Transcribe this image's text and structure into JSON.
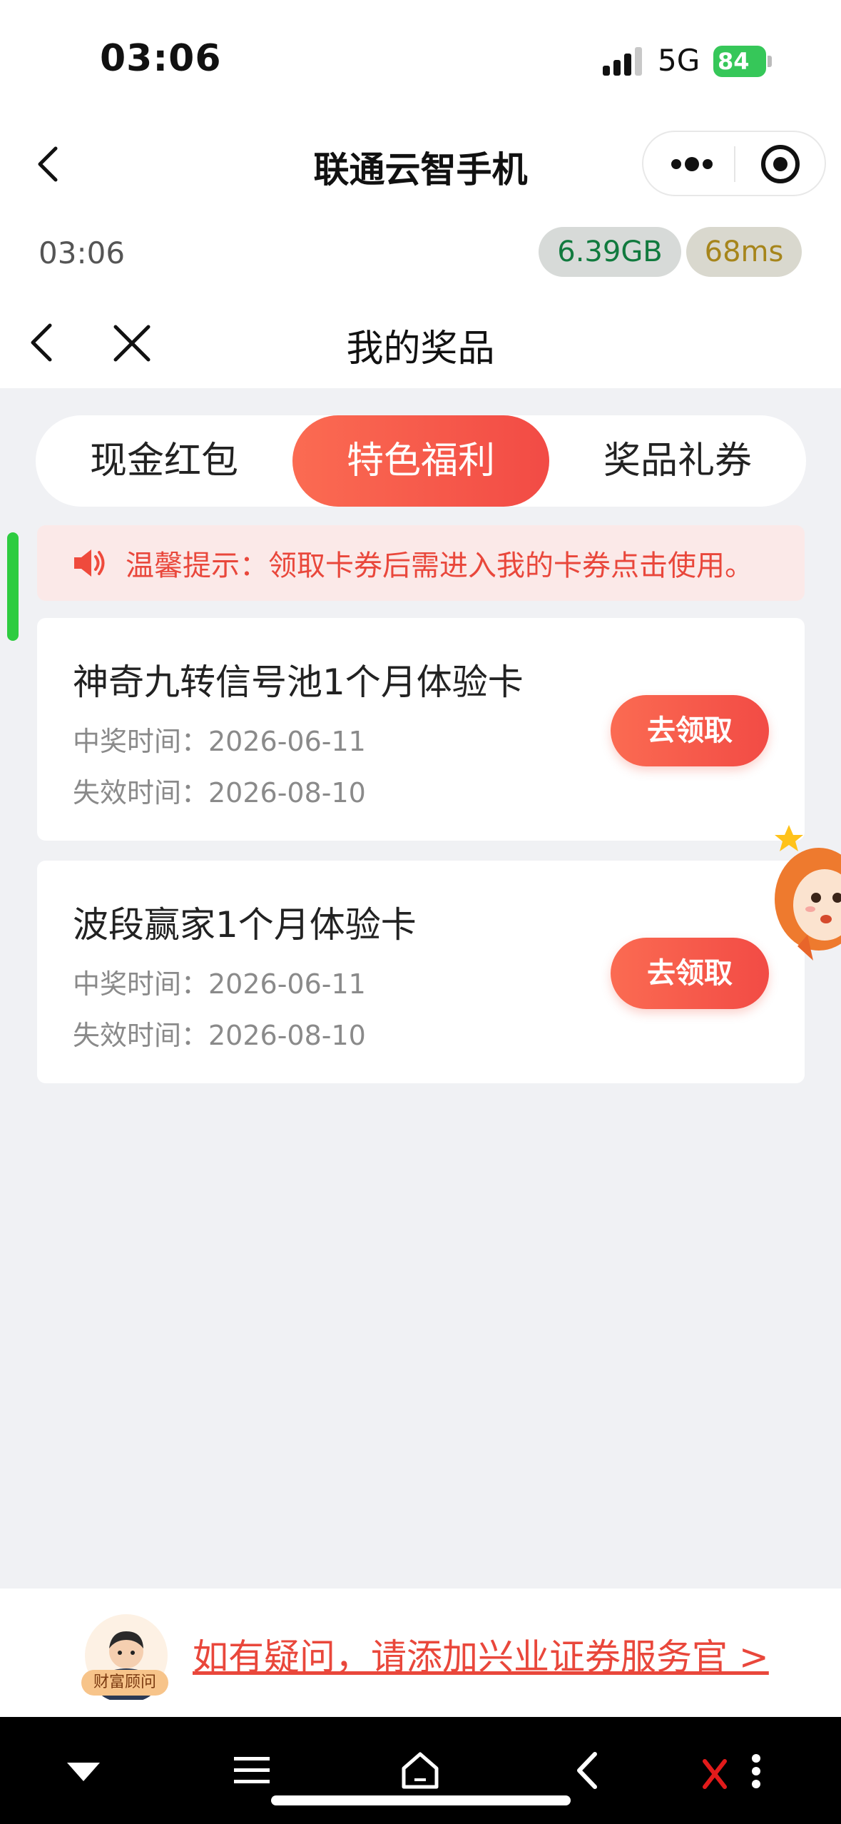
{
  "status_bar": {
    "time": "03:06",
    "network": "5G",
    "battery": "84"
  },
  "miniprogram": {
    "title": "联通云智手机"
  },
  "info": {
    "time": "03:06",
    "memory": "6.39GB",
    "latency": "68ms"
  },
  "page": {
    "title": "我的奖品"
  },
  "tabs": [
    {
      "label": "现金红包",
      "active": false
    },
    {
      "label": "特色福利",
      "active": true
    },
    {
      "label": "奖品礼券",
      "active": false
    }
  ],
  "notice": {
    "text": "温馨提示：领取卡券后需进入我的卡券点击使用。"
  },
  "prizes": [
    {
      "title": "神奇九转信号池1个月体验卡",
      "win_time": "中奖时间：2026-06-11",
      "expire_time": "失效时间：2026-08-10",
      "button": "去领取"
    },
    {
      "title": "波段赢家1个月体验卡",
      "win_time": "中奖时间：2026-06-11",
      "expire_time": "失效时间：2026-08-10",
      "button": "去领取"
    }
  ],
  "help": {
    "advisor_label": "财富顾问",
    "link_text": "如有疑问，请添加兴业证券服务官 >"
  },
  "colors": {
    "accent": "#f24b45",
    "notice_bg": "#fbe9e8",
    "page_bg": "#f0f1f4"
  },
  "icons": [
    "back-icon",
    "more-icon",
    "record-icon",
    "close-icon",
    "speaker-icon",
    "advisor-avatar",
    "mascot",
    "nav-down-icon",
    "nav-menu-icon",
    "nav-home-icon",
    "nav-back-icon"
  ]
}
